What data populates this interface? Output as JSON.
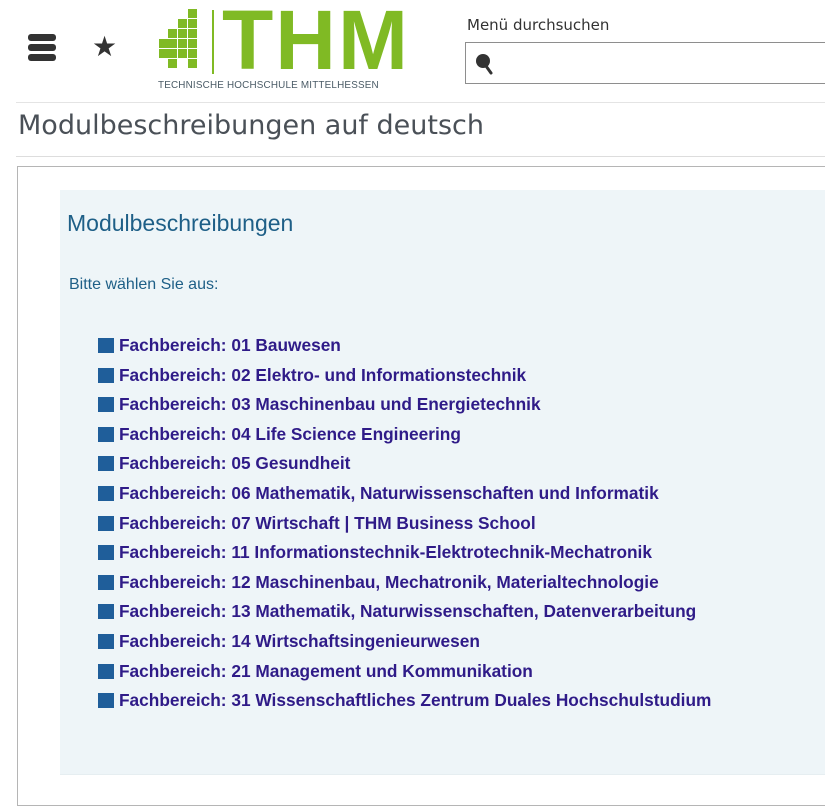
{
  "header": {
    "menu_icon": "hamburger-menu-icon",
    "favorites_icon": "star-icon",
    "favorites_glyph": "★",
    "logo": {
      "wordmark": "THM",
      "subtitle": "TECHNISCHE HOCHSCHULE MITTELHESSEN",
      "brand_color": "#80ba24"
    },
    "search": {
      "label": "Menü durchsuchen",
      "value": "",
      "placeholder": "",
      "icon": "search-icon"
    }
  },
  "page": {
    "title": "Modulbeschreibungen auf deutsch"
  },
  "panel": {
    "heading": "Modulbeschreibungen",
    "prompt": "Bitte wählen Sie aus:",
    "heading_color": "#1e5f87",
    "link_color": "#2f1b88",
    "bullet_color": "#1f5e9a",
    "background_color": "#eef5f8",
    "departments": [
      {
        "label": "Fachbereich: 01 Bauwesen"
      },
      {
        "label": "Fachbereich: 02 Elektro- und Informationstechnik"
      },
      {
        "label": "Fachbereich: 03 Maschinenbau und Energietechnik"
      },
      {
        "label": "Fachbereich: 04 Life Science Engineering"
      },
      {
        "label": "Fachbereich: 05 Gesundheit"
      },
      {
        "label": "Fachbereich: 06 Mathematik, Naturwissenschaften und Informatik"
      },
      {
        "label": "Fachbereich: 07 Wirtschaft | THM Business School"
      },
      {
        "label": "Fachbereich: 11 Informationstechnik-Elektrotechnik-Mechatronik"
      },
      {
        "label": "Fachbereich: 12 Maschinenbau, Mechatronik, Materialtechnologie"
      },
      {
        "label": "Fachbereich: 13 Mathematik, Naturwissenschaften, Datenverarbeitung"
      },
      {
        "label": "Fachbereich: 14 Wirtschaftsingenieurwesen"
      },
      {
        "label": "Fachbereich: 21 Management und Kommunikation"
      },
      {
        "label": "Fachbereich: 31 Wissenschaftliches Zentrum Duales Hochschulstudium"
      }
    ]
  }
}
